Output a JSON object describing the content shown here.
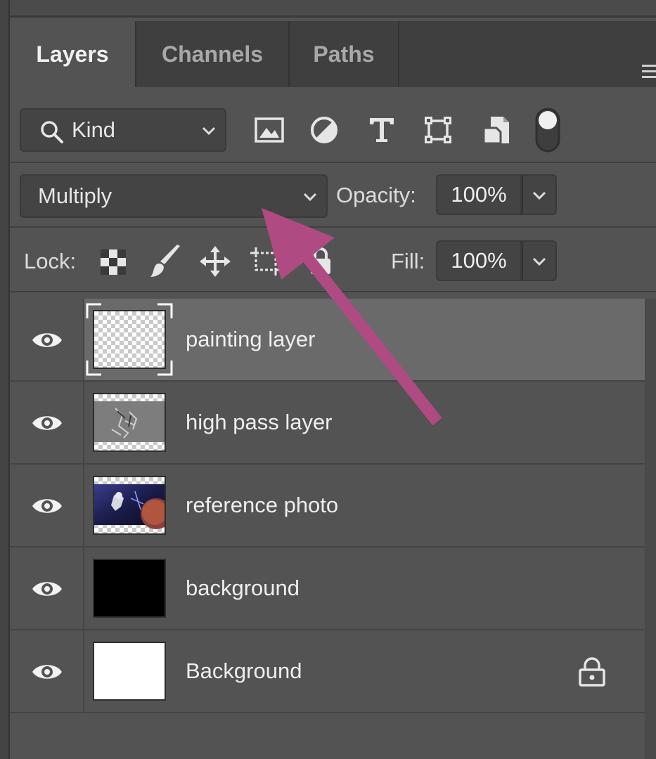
{
  "tabs": [
    {
      "label": "Layers",
      "active": true
    },
    {
      "label": "Channels",
      "active": false
    },
    {
      "label": "Paths",
      "active": false
    }
  ],
  "filter": {
    "kind_label": "Kind",
    "icons": [
      "image-filter-icon",
      "adjustment-filter-icon",
      "type-filter-icon",
      "shape-filter-icon",
      "smart-object-filter-icon",
      "filter-toggle-icon"
    ]
  },
  "blend": {
    "mode": "Multiply",
    "opacity_label": "Opacity:",
    "opacity_value": "100%"
  },
  "lock": {
    "label": "Lock:",
    "fill_label": "Fill:",
    "fill_value": "100%"
  },
  "layers": [
    {
      "name": "painting layer",
      "thumb": "transparent",
      "selected": true,
      "locked": false
    },
    {
      "name": "high pass layer",
      "thumb": "highpass",
      "selected": false,
      "locked": false
    },
    {
      "name": "reference photo",
      "thumb": "photo",
      "selected": false,
      "locked": false
    },
    {
      "name": "background",
      "thumb": "black",
      "selected": false,
      "locked": false
    },
    {
      "name": "Background",
      "thumb": "white",
      "selected": false,
      "locked": true
    }
  ],
  "colors": {
    "panel": "#535353",
    "selected_row": "#6a6a6a",
    "annotation_arrow": "#b04a82"
  }
}
